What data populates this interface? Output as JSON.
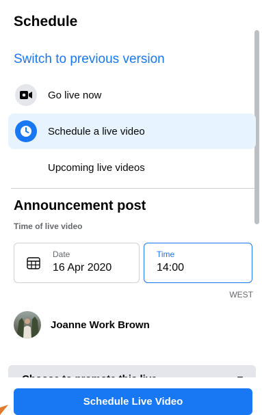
{
  "header": {
    "title": "Schedule",
    "switch_link": "Switch to previous version"
  },
  "nav": {
    "items": [
      {
        "label": "Go live now",
        "icon": "video-camera-icon",
        "active": false
      },
      {
        "label": "Schedule a live video",
        "icon": "clock-icon",
        "active": true
      },
      {
        "label": "Upcoming live videos",
        "icon": "",
        "active": false
      }
    ]
  },
  "announcement": {
    "title": "Announcement post",
    "time_caption": "Time of live video",
    "date_label": "Date",
    "date_value": "16 Apr 2020",
    "time_label": "Time",
    "time_value": "14:00",
    "timezone": "WEST",
    "profile_name": "Joanne Work Brown"
  },
  "collapsed_section": {
    "label": "Choose to promote this live",
    "icon": "chevron-down-icon"
  },
  "footer": {
    "primary_button": "Schedule Live Video"
  },
  "colors": {
    "accent": "#1877f2",
    "active_background": "#e7f3ff",
    "secondary_text": "#65676b",
    "divider": "#ced0d4"
  }
}
